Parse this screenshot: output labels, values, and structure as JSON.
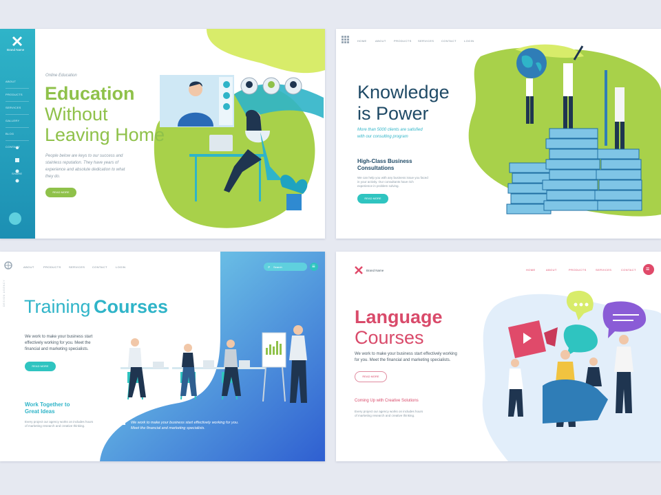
{
  "panel1": {
    "brand": "Brand Name",
    "nav": [
      "ABOUT",
      "PRODUCTS",
      "SERVICES",
      "GALLERY",
      "BLOG",
      "CONTACT"
    ],
    "share_label": "SHARE",
    "eyebrow": "Online Education",
    "title_bold": "Education",
    "title_line2": "Without",
    "title_line3": "Leaving Home",
    "body": "People below are keys to our success and stainless reputation. They have years of experience and absolute dedication to what they do.",
    "button": "READ MORE",
    "accent": "#8fc14a",
    "sidebar_color": "#2fb4c8"
  },
  "panel2": {
    "nav": [
      "HOME",
      "ABOUT",
      "PRODUCTS",
      "SERVICES",
      "CONTACT",
      "LOGIN"
    ],
    "title_line1": "Knowledge",
    "title_line2": "is Power",
    "italic_line1": "More than 5000 clients are satisfied",
    "italic_line2": "with our consulting program",
    "sub_line1": "High-Class Business",
    "sub_line2": "Consultations",
    "body_line1": "We can help you with any business issue you faced",
    "body_line2": "in your activity. Our consultants have rich",
    "body_line3": "experience in problem solving.",
    "button": "READ MORE",
    "accent": "#2fc4c0"
  },
  "panel3": {
    "logo_text": "DESIGN AGENCY",
    "nav": [
      "ABOUT",
      "PRODUCTS",
      "SERVICES",
      "CONTACT",
      "LOGIN"
    ],
    "search_placeholder": "Search",
    "title_light": "Training",
    "title_bold": "Courses",
    "body_line1": "We work to make your business start",
    "body_line2": "effectively working for you. Meet the",
    "body_line3": "financial and marketing specialists.",
    "button": "READ MORE",
    "sub_line1": "Work Together to",
    "sub_line2": "Great Ideas",
    "small_line1": "Every project our agency works on includes hours",
    "small_line2": "of marketing research and creative thinking.",
    "footer_line1": "We work to make your business start effectively working for you.",
    "footer_line2": "Meet the financial and marketing specialists.",
    "accent": "#2fb4c8"
  },
  "panel4": {
    "brand": "Brand Name",
    "nav": [
      "HOME",
      "ABOUT",
      "PRODUCTS",
      "SERVICES",
      "CONTACT"
    ],
    "title_bold": "Language",
    "title_line2": "Courses",
    "body_line1": "We work to make your business start effectively working",
    "body_line2": "for you. Meet the financial and marketing specialists.",
    "button": "READ MORE",
    "sub": "Coming Up with Creative Solutions",
    "small_line1": "Every project our agency works on includes hours",
    "small_line2": "of marketing research and creative thinking.",
    "accent": "#d94a6a"
  }
}
